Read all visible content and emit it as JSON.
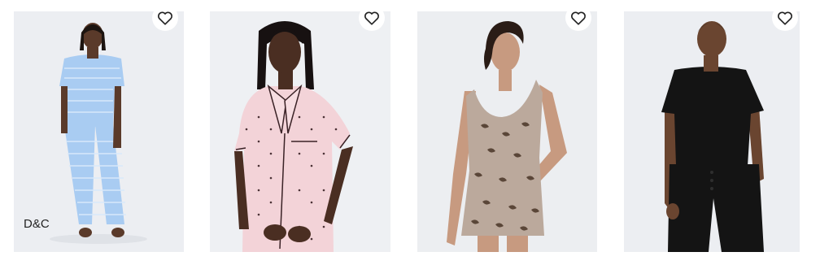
{
  "products": [
    {
      "id_label": "card-1",
      "brand_tag": "D&C",
      "image_desc": "woman-blue-striped-short-sleeve-pajama-set",
      "colors": {
        "background": "#eceef2",
        "garment": "#a9ccf2",
        "stripe": "#d8e8fa",
        "skin": "#5a3a2a",
        "hair": "#1c1410"
      }
    },
    {
      "id_label": "card-2",
      "brand_tag": "",
      "image_desc": "woman-pink-polka-dot-button-pajama-top",
      "colors": {
        "background": "#eef0f3",
        "garment": "#f3d3d8",
        "piping": "#3a2226",
        "dot": "#4b3236",
        "skin": "#4a2e22",
        "hair": "#171111"
      }
    },
    {
      "id_label": "card-3",
      "brand_tag": "",
      "image_desc": "woman-leopard-print-tank-and-shorts-set",
      "colors": {
        "background": "#eceef1",
        "garment": "#bba99c",
        "pattern": "#5a4638",
        "skin": "#c79a80",
        "hair": "#2a1c16"
      }
    },
    {
      "id_label": "card-4",
      "brand_tag": "",
      "image_desc": "woman-black-tee-and-pants-pajama-set",
      "colors": {
        "background": "#eceef2",
        "garment": "#141414",
        "skin": "#6a4530",
        "hair": "#1b1410"
      }
    }
  ],
  "icons": {
    "wishlist": "heart-outline-icon"
  }
}
